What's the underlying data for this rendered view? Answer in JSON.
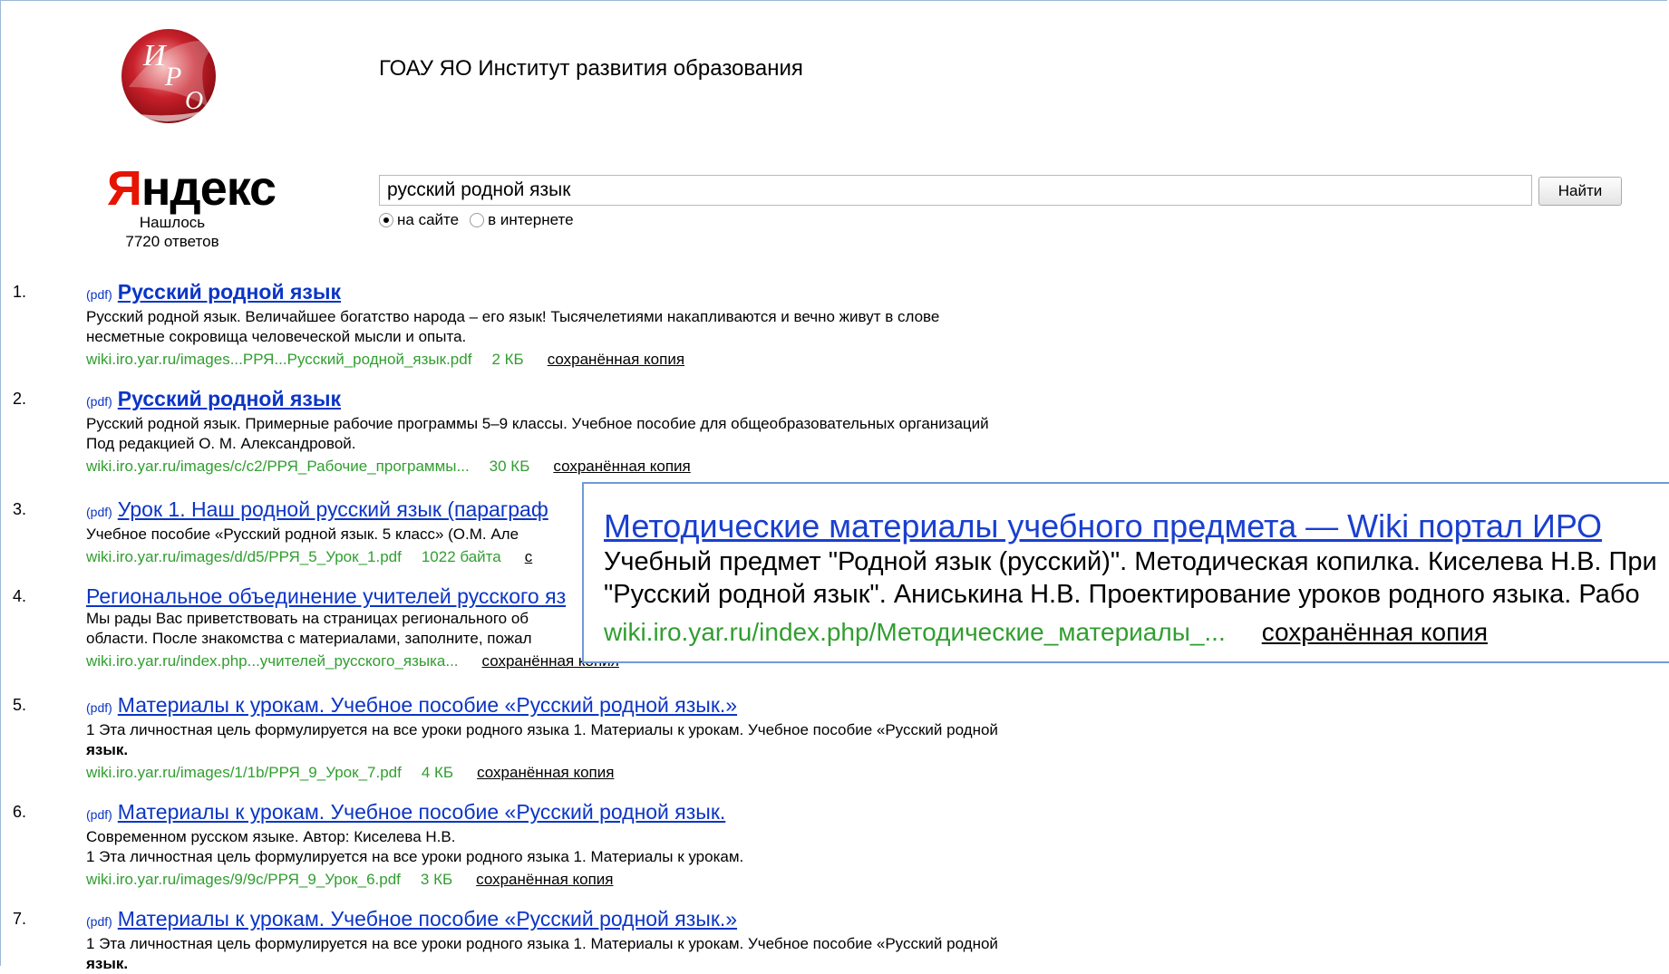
{
  "header": {
    "logo_letters": [
      "И",
      "Р",
      "О"
    ],
    "site_title": "ГОАУ ЯО Институт развития образования",
    "yandex_logo": "Яндекс",
    "found_label": "Нашлось",
    "found_count": "7720 ответов"
  },
  "search": {
    "query": "русский родной язык",
    "button_label": "Найти",
    "scope_site": "на сайте",
    "scope_internet": "в интернете",
    "selected_scope": "на сайте"
  },
  "results": [
    {
      "num": "1.",
      "pdf": "(pdf)",
      "title": "Русский родной язык",
      "snippet1": "Русский родной язык. Величайшее богатство народа – его язык! Тысячелетиями накапливаются и вечно живут в слове",
      "snippet2": "несметные сокровища человеческой мысли и опыта.",
      "url": "wiki.iro.yar.ru/images...РРЯ...Русский_родной_язык.pdf",
      "size": "2 КБ",
      "copy": "сохранённая копия"
    },
    {
      "num": "2.",
      "pdf": "(pdf)",
      "title": "Русский родной язык",
      "snippet1": "Русский родной язык. Примерные рабочие программы 5–9 классы. Учебное пособие для общеобразовательных организаций",
      "snippet2": "Под редакцией О. М. Александровой.",
      "url": "wiki.iro.yar.ru/images/c/c2/РРЯ_Рабочие_программы...",
      "size": "30 КБ",
      "copy": "сохранённая копия"
    },
    {
      "num": "3.",
      "pdf": "(pdf)",
      "title": "Урок 1. Наш родной русский язык (параграф",
      "snippet1": "Учебное пособие «Русский родной язык. 5 класс» (О.М. Але",
      "url": "wiki.iro.yar.ru/images/d/d5/РРЯ_5_Урок_1.pdf",
      "size": "1022 байта",
      "copy": "с"
    },
    {
      "num": "4.",
      "title": "Региональное объединение учителей русского яз",
      "snippet1": "Мы рады Вас приветствовать на страницах регионального об",
      "snippet2": "области. После знакомства с материалами, заполните, пожал",
      "url": "wiki.iro.yar.ru/index.php...учителей_русского_языка...",
      "copy": "сохранённая копия"
    },
    {
      "num": "5.",
      "pdf": "(pdf)",
      "title": "Материалы к урокам. Учебное пособие «Русский родной язык.»",
      "snippet1": "1 Эта личностная цель формулируется на все уроки родного языка 1. Материалы к урокам. Учебное пособие «Русский родной",
      "snippet2": "язык.",
      "url": "wiki.iro.yar.ru/images/1/1b/РРЯ_9_Урок_7.pdf",
      "size": "4 КБ",
      "copy": "сохранённая копия"
    },
    {
      "num": "6.",
      "pdf": "(pdf)",
      "title": "Материалы к урокам. Учебное пособие «Русский родной язык.",
      "snippet1": "Современном русском языке. Автор: Киселева Н.В.",
      "snippet2": "1 Эта личностная цель формулируется на все уроки родного языка 1. Материалы к урокам.",
      "url": "wiki.iro.yar.ru/images/9/9c/РРЯ_9_Урок_6.pdf",
      "size": "3 КБ",
      "copy": "сохранённая копия"
    },
    {
      "num": "7.",
      "pdf": "(pdf)",
      "title": "Материалы к урокам. Учебное пособие «Русский родной язык.»",
      "snippet1": "1 Эта личностная цель формулируется на все уроки родного языка 1. Материалы к урокам. Учебное пособие «Русский родной",
      "snippet2": "язык."
    }
  ],
  "zoom": {
    "title": "Методические материалы учебного предмета — Wiki портал ИРО",
    "snippet1": "Учебный предмет \"Родной язык (русский)\". Методическая копилка. Киселева Н.В. При",
    "snippet2": "\"Русский родной язык\". Аниськина Н.В. Проектирование уроков родного языка. Рабо",
    "url": "wiki.iro.yar.ru/index.php/Методические_материалы_...",
    "copy": "сохранённая копия"
  },
  "colors": {
    "link": "#0b35c6",
    "url_green": "#319e30",
    "yandex_red": "#e61400",
    "popup_border": "#6f9ad6"
  }
}
